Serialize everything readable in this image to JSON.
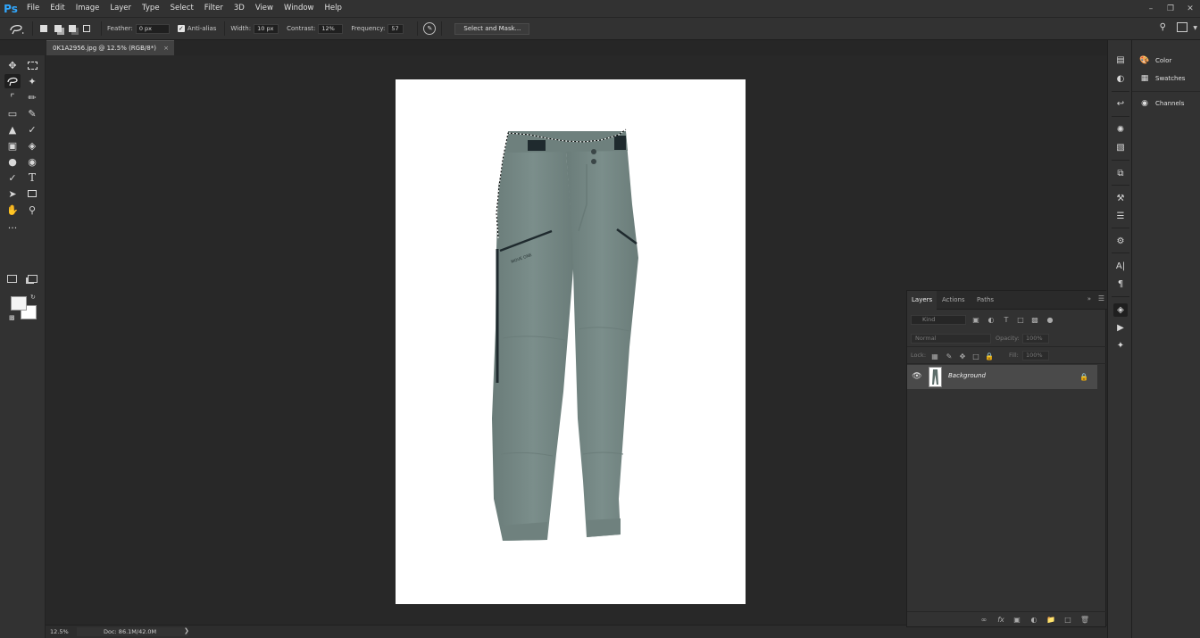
{
  "app": {
    "logo": "Ps"
  },
  "menu": [
    "File",
    "Edit",
    "Image",
    "Layer",
    "Type",
    "Select",
    "Filter",
    "3D",
    "View",
    "Window",
    "Help"
  ],
  "window_controls": [
    "minimize-icon",
    "restore-icon",
    "close-icon"
  ],
  "options": {
    "feather_label": "Feather:",
    "feather_value": "0 px",
    "antialias_label": "Anti-alias",
    "antialias_checked": true,
    "width_label": "Width:",
    "width_value": "10 px",
    "contrast_label": "Contrast:",
    "contrast_value": "12%",
    "frequency_label": "Frequency:",
    "frequency_value": "57",
    "select_mask_label": "Select and Mask..."
  },
  "document": {
    "tab_title": "0K1A2956.jpg @ 12.5% (RGB/8*)",
    "close": "×",
    "canvas_color": "#ffffff",
    "subject": "grey hiking pants with magnetic-lasso selection",
    "pants_color": "#7b8e8b"
  },
  "status": {
    "zoom": "12.5%",
    "doc_info": "Doc: 86.1M/42.0M",
    "arrow": "❯"
  },
  "right_panel": {
    "items": [
      {
        "icon": "color-palette-icon",
        "label": "Color"
      },
      {
        "icon": "swatches-grid-icon",
        "label": "Swatches"
      },
      {
        "icon": "channels-icon",
        "label": "Channels"
      }
    ]
  },
  "layers": {
    "tabs": [
      "Layers",
      "Actions",
      "Paths"
    ],
    "active_tab": "Layers",
    "kind_placeholder": "Kind",
    "blend_mode": "Normal",
    "opacity_label": "Opacity:",
    "opacity_value": "100%",
    "lock_label": "Lock:",
    "fill_label": "Fill:",
    "fill_value": "100%",
    "items": [
      {
        "name": "Background",
        "visible": true,
        "locked": true
      }
    ]
  }
}
